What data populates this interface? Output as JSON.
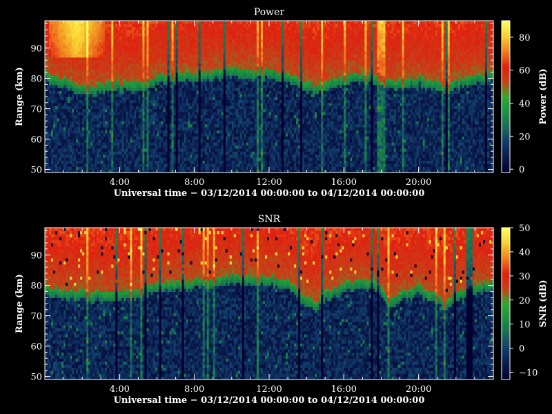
{
  "colors": {
    "background": "#000000",
    "foreground": "#ffffff"
  },
  "chart_data": [
    {
      "type": "heatmap",
      "title": "Power",
      "xlabel": "Universal time − 03/12/2014 00:00:00 to 04/12/2014 00:00:00",
      "ylabel": "Range (km)",
      "colorbar_label": "Power (dB)",
      "x_range_hours": [
        0,
        24
      ],
      "y_range_km": [
        49,
        99
      ],
      "x_ticks": [
        4,
        8,
        12,
        16,
        20
      ],
      "x_tick_labels": [
        "4:00",
        "8:00",
        "12:00",
        "16:00",
        "20:00"
      ],
      "y_ticks": [
        50,
        60,
        70,
        80,
        90
      ],
      "y_tick_labels": [
        "50",
        "60",
        "70",
        "80",
        "90"
      ],
      "colorbar_range": [
        -2,
        90
      ],
      "colorbar_ticks": [
        0,
        20,
        40,
        60,
        80
      ],
      "colorbar_tick_labels": [
        "0",
        "20",
        "40",
        "60",
        "80"
      ],
      "colormap": [
        "#000030",
        "#0a1a4a",
        "#103a6a",
        "#1a6a5a",
        "#1a9040",
        "#30a830",
        "#c84018",
        "#e02010",
        "#f08020",
        "#f8d030",
        "#ffff60"
      ],
      "boundary_km": [
        [
          0,
          82
        ],
        [
          1,
          80
        ],
        [
          2,
          78
        ],
        [
          3,
          78
        ],
        [
          4,
          79
        ],
        [
          5,
          79
        ],
        [
          5.5,
          80
        ],
        [
          6,
          81
        ],
        [
          8,
          82
        ],
        [
          10,
          84
        ],
        [
          11,
          83
        ],
        [
          12,
          83
        ],
        [
          13,
          82
        ],
        [
          14,
          79
        ],
        [
          14.5,
          78
        ],
        [
          15,
          79
        ],
        [
          16,
          81
        ],
        [
          17,
          82
        ],
        [
          18,
          81
        ],
        [
          18.5,
          79
        ],
        [
          19,
          80
        ],
        [
          20,
          81
        ],
        [
          21,
          79
        ],
        [
          21.5,
          78
        ],
        [
          22,
          80
        ],
        [
          23,
          81
        ],
        [
          24,
          82
        ]
      ],
      "strong_echo": {
        "time_range_hours": [
          0.2,
          3.2
        ],
        "range_km": [
          87,
          99
        ],
        "peak_db": 90
      }
    },
    {
      "type": "heatmap",
      "title": "SNR",
      "xlabel": "Universal time − 03/12/2014 00:00:00 to 04/12/2014 00:00:00",
      "ylabel": "Range (km)",
      "colorbar_label": "SNR (dB)",
      "x_range_hours": [
        0,
        24
      ],
      "y_range_km": [
        49,
        99
      ],
      "x_ticks": [
        4,
        8,
        12,
        16,
        20
      ],
      "x_tick_labels": [
        "4:00",
        "8:00",
        "12:00",
        "16:00",
        "20:00"
      ],
      "y_ticks": [
        50,
        60,
        70,
        80,
        90
      ],
      "y_tick_labels": [
        "50",
        "60",
        "70",
        "80",
        "90"
      ],
      "colorbar_range": [
        -13,
        50
      ],
      "colorbar_ticks": [
        -10,
        0,
        10,
        20,
        30,
        40,
        50
      ],
      "colorbar_tick_labels": [
        "−10",
        "0",
        "10",
        "20",
        "30",
        "40",
        "50"
      ],
      "colormap": [
        "#000030",
        "#0a1a4a",
        "#103a6a",
        "#1a6a5a",
        "#1a9040",
        "#30a830",
        "#c84018",
        "#e02010",
        "#f08020",
        "#f8d030",
        "#ffff60"
      ],
      "boundary_km": [
        [
          0,
          80
        ],
        [
          1,
          79
        ],
        [
          2,
          78
        ],
        [
          3,
          78
        ],
        [
          4,
          78
        ],
        [
          5,
          79
        ],
        [
          5.5,
          80
        ],
        [
          6,
          81
        ],
        [
          8,
          82
        ],
        [
          10,
          84
        ],
        [
          11,
          83
        ],
        [
          12,
          83
        ],
        [
          13,
          82
        ],
        [
          14,
          76
        ],
        [
          14.5,
          75
        ],
        [
          15,
          78
        ],
        [
          16,
          81
        ],
        [
          17,
          82
        ],
        [
          18,
          80
        ],
        [
          18.5,
          76
        ],
        [
          19,
          78
        ],
        [
          20,
          80
        ],
        [
          21,
          77
        ],
        [
          21.5,
          75
        ],
        [
          22,
          78
        ],
        [
          23,
          80
        ],
        [
          24,
          82
        ]
      ]
    }
  ]
}
